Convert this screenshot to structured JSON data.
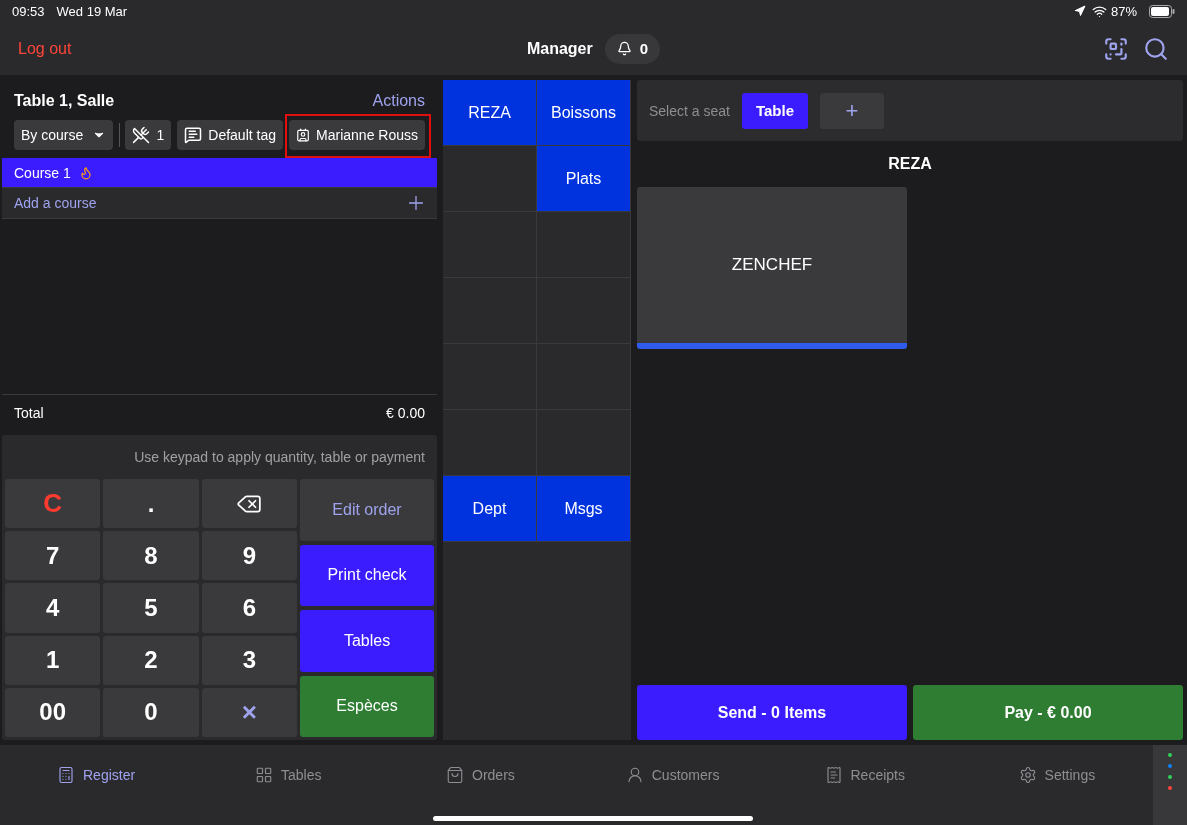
{
  "status_bar": {
    "time": "09:53",
    "date": "Wed 19 Mar",
    "battery": "87%"
  },
  "header": {
    "logout": "Log out",
    "title": "Manager",
    "notifications": "0"
  },
  "order": {
    "title": "Table 1, Salle",
    "actions": "Actions",
    "mode": "By course",
    "covers": "1",
    "tag": "Default tag",
    "customer": {
      "label": "Marianne Rouss",
      "highlighted": true
    },
    "courses": [
      {
        "label": "Course 1",
        "selected": true,
        "fired": true
      }
    ],
    "add_course": "Add a course",
    "total_label": "Total",
    "total": "€ 0.00"
  },
  "keypad": {
    "hint": "Use keypad to apply quantity, table or payment",
    "keys": [
      {
        "kind": "clear",
        "label": "C"
      },
      {
        "kind": "digit",
        "label": "."
      },
      {
        "kind": "backspace"
      },
      {
        "kind": "digit",
        "label": "7"
      },
      {
        "kind": "digit",
        "label": "8"
      },
      {
        "kind": "digit",
        "label": "9"
      },
      {
        "kind": "digit",
        "label": "4"
      },
      {
        "kind": "digit",
        "label": "5"
      },
      {
        "kind": "digit",
        "label": "6"
      },
      {
        "kind": "digit",
        "label": "1"
      },
      {
        "kind": "digit",
        "label": "2"
      },
      {
        "kind": "digit",
        "label": "3"
      },
      {
        "kind": "digit",
        "label": "00"
      },
      {
        "kind": "digit",
        "label": "0"
      },
      {
        "kind": "multiply",
        "label": "×"
      }
    ],
    "actions": [
      {
        "kind": "neutral",
        "label": "Edit order"
      },
      {
        "kind": "primary",
        "label": "Print check"
      },
      {
        "kind": "primary",
        "label": "Tables"
      },
      {
        "kind": "cash",
        "label": "Espèces"
      }
    ]
  },
  "categories": [
    {
      "kind": "category",
      "label": "REZA"
    },
    {
      "kind": "category",
      "label": "Boissons"
    },
    {
      "kind": "blank"
    },
    {
      "kind": "category",
      "label": "Plats"
    },
    {
      "kind": "blank"
    },
    {
      "kind": "blank"
    },
    {
      "kind": "blank"
    },
    {
      "kind": "blank"
    },
    {
      "kind": "blank"
    },
    {
      "kind": "blank"
    },
    {
      "kind": "blank"
    },
    {
      "kind": "blank"
    },
    {
      "kind": "category",
      "label": "Dept"
    },
    {
      "kind": "category",
      "label": "Msgs"
    }
  ],
  "seats": {
    "prompt": "Select a seat",
    "options": [
      {
        "label": "Table",
        "selected": true
      }
    ],
    "add": "+"
  },
  "products": {
    "title": "REZA",
    "items": [
      {
        "label": "ZENCHEF",
        "color": "#2f5bea"
      }
    ]
  },
  "footer_buttons": [
    {
      "kind": "primary",
      "label": "Send - 0 Items"
    },
    {
      "kind": "cash",
      "label": "Pay - € 0.00"
    }
  ],
  "nav": [
    {
      "label": "Register",
      "selected": true
    },
    {
      "label": "Tables",
      "selected": false
    },
    {
      "label": "Orders",
      "selected": false
    },
    {
      "label": "Customers",
      "selected": false
    },
    {
      "label": "Receipts",
      "selected": false
    },
    {
      "label": "Settings",
      "selected": false
    }
  ]
}
